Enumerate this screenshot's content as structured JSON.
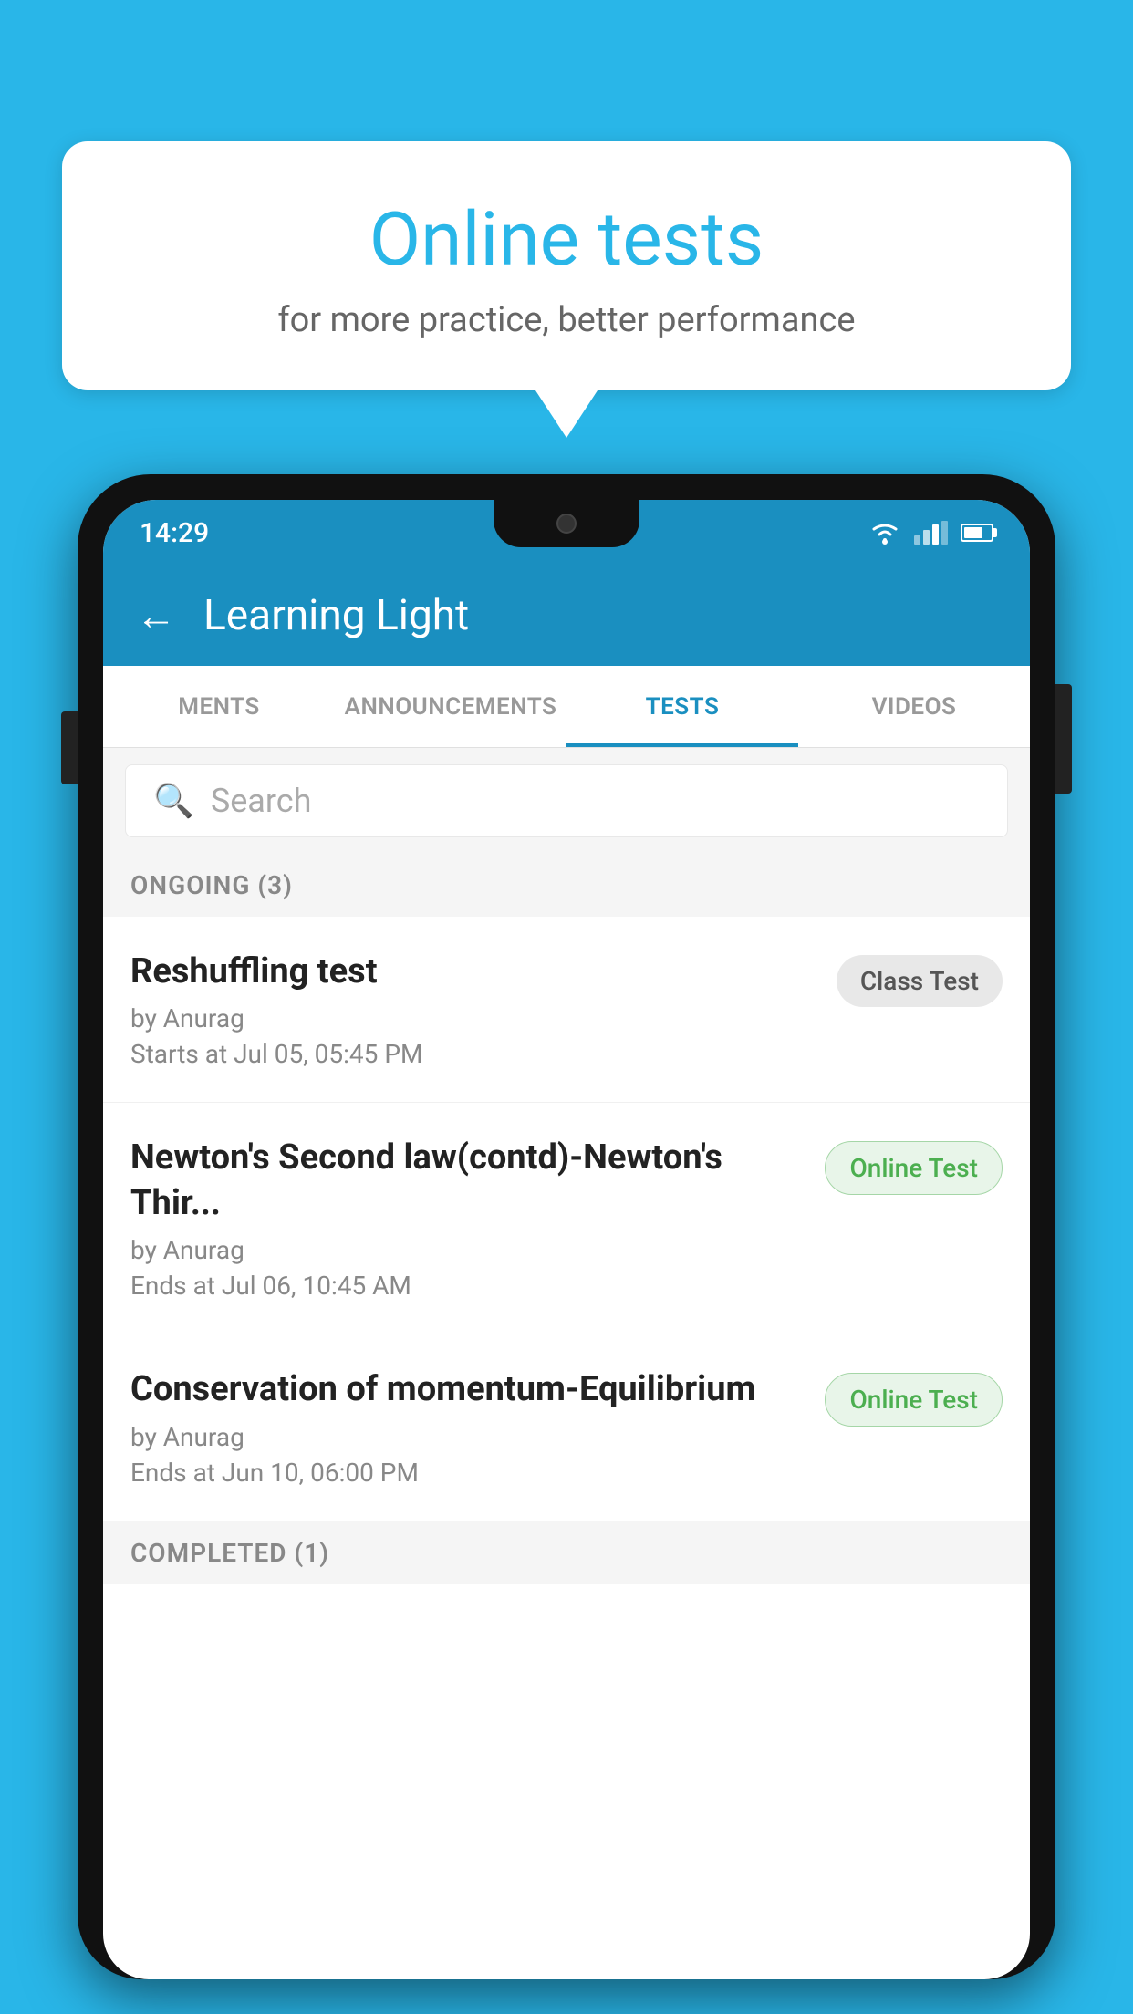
{
  "background_color": "#29b6e8",
  "speech_bubble": {
    "title": "Online tests",
    "subtitle": "for more practice, better performance"
  },
  "phone": {
    "status_bar": {
      "time": "14:29"
    },
    "app_bar": {
      "back_label": "←",
      "title": "Learning Light"
    },
    "tabs": [
      {
        "label": "MENTS",
        "active": false
      },
      {
        "label": "ANNOUNCEMENTS",
        "active": false
      },
      {
        "label": "TESTS",
        "active": true
      },
      {
        "label": "VIDEOS",
        "active": false
      }
    ],
    "search": {
      "placeholder": "Search"
    },
    "ongoing_section": {
      "label": "ONGOING (3)"
    },
    "tests": [
      {
        "title": "Reshuffling test",
        "author": "by Anurag",
        "time": "Starts at  Jul 05, 05:45 PM",
        "badge": "Class Test",
        "badge_type": "class"
      },
      {
        "title": "Newton's Second law(contd)-Newton's Thir...",
        "author": "by Anurag",
        "time": "Ends at  Jul 06, 10:45 AM",
        "badge": "Online Test",
        "badge_type": "online"
      },
      {
        "title": "Conservation of momentum-Equilibrium",
        "author": "by Anurag",
        "time": "Ends at  Jun 10, 06:00 PM",
        "badge": "Online Test",
        "badge_type": "online"
      }
    ],
    "completed_section": {
      "label": "COMPLETED (1)"
    }
  }
}
